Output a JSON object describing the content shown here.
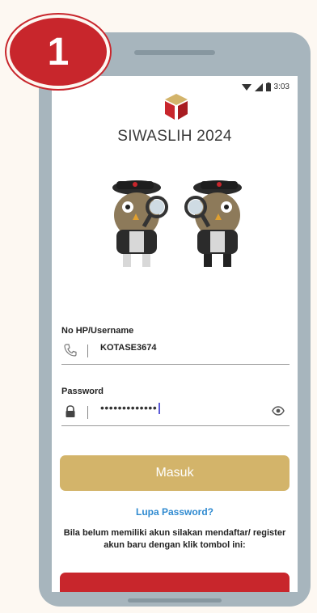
{
  "step_badge": "1",
  "status_bar": {
    "time": "3:03"
  },
  "app": {
    "title": "SIWASLIH 2024"
  },
  "form": {
    "username_label": "No HP/Username",
    "username_value": "KOTASE3674",
    "password_label": "Password",
    "password_value": "•••••••••••••"
  },
  "actions": {
    "login_label": "Masuk",
    "forgot_label": "Lupa Password?",
    "register_info": "Bila belum memiliki akun silakan mendaftar/ register akun baru dengan klik tombol ini:"
  },
  "colors": {
    "badge": "#c8262c",
    "login_button": "#d3b46a",
    "forgot_link": "#2f8ad0",
    "register_button": "#c8262c"
  },
  "icons": [
    "signal-icon",
    "battery-icon",
    "app-logo-icon",
    "phone-icon",
    "lock-icon",
    "eye-icon"
  ]
}
